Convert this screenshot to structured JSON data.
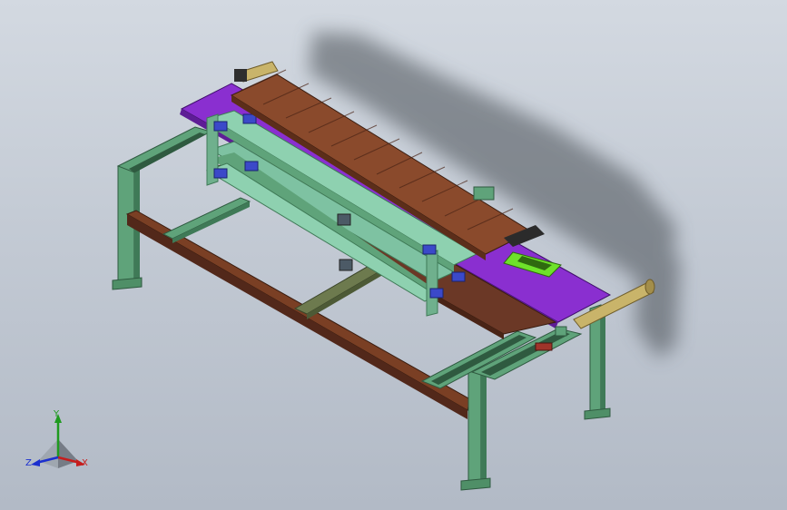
{
  "viewport": {
    "background_top": "#d3d9e1",
    "background_bottom": "#b2bac6"
  },
  "colors": {
    "frame_green": "#5fa37a",
    "frame_green_dark": "#3f7a57",
    "purple_plate": "#8a2fd0",
    "purple_dark": "#5e1d96",
    "brown_beam": "#7a3f24",
    "brown_dark": "#52281a",
    "conveyor_brown": "#8a4a2c",
    "roller_tan": "#c9b46a",
    "blue_block": "#3b49c9",
    "lime": "#6ee22a",
    "mint_slide": "#8ed1b0",
    "shadow": "#4a4f55"
  },
  "triad": {
    "x_label": "X",
    "y_label": "Y",
    "z_label": "Z",
    "x_color": "#c61d1d",
    "y_color": "#1f9a1f",
    "z_color": "#1b2fcf"
  }
}
